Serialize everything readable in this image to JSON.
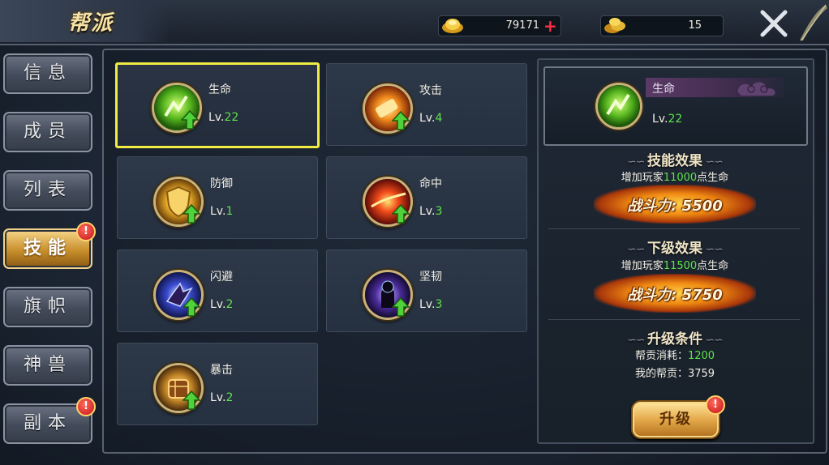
{
  "header": {
    "title": "帮派",
    "gold": "79171",
    "ingot": "15"
  },
  "tabs": [
    {
      "label": "信息",
      "active": false,
      "badge": ""
    },
    {
      "label": "成员",
      "active": false,
      "badge": ""
    },
    {
      "label": "列表",
      "active": false,
      "badge": ""
    },
    {
      "label": "技能",
      "active": true,
      "badge": "!"
    },
    {
      "label": "旗帜",
      "active": false,
      "badge": ""
    },
    {
      "label": "神兽",
      "active": false,
      "badge": ""
    },
    {
      "label": "副本",
      "active": false,
      "badge": "!"
    }
  ],
  "skills": [
    {
      "name": "生命",
      "lv_prefix": "Lv.",
      "level": "22",
      "icon": "life-icon",
      "selected": true
    },
    {
      "name": "攻击",
      "lv_prefix": "Lv.",
      "level": "4",
      "icon": "attack-icon",
      "selected": false
    },
    {
      "name": "防御",
      "lv_prefix": "Lv.",
      "level": "1",
      "icon": "defense-icon",
      "selected": false
    },
    {
      "name": "命中",
      "lv_prefix": "Lv.",
      "level": "3",
      "icon": "hit-icon",
      "selected": false
    },
    {
      "name": "闪避",
      "lv_prefix": "Lv.",
      "level": "2",
      "icon": "dodge-icon",
      "selected": false
    },
    {
      "name": "坚韧",
      "lv_prefix": "Lv.",
      "level": "3",
      "icon": "toughness-icon",
      "selected": false
    },
    {
      "name": "暴击",
      "lv_prefix": "Lv.",
      "level": "2",
      "icon": "crit-icon",
      "selected": false
    }
  ],
  "detail": {
    "name": "生命",
    "lv_prefix": "Lv.",
    "level": "22",
    "effect_title": "技能效果",
    "effect_desc_pre": "增加玩家",
    "effect_value": "11000",
    "effect_desc_post": "点生命",
    "effect_power": "战斗力: 5500",
    "next_title": "下级效果",
    "next_desc_pre": "增加玩家",
    "next_value": "11500",
    "next_desc_post": "点生命",
    "next_power": "战斗力: 5750",
    "cond_title": "升级条件",
    "cost_label": "帮贡消耗：",
    "cost_value": "1200",
    "own_label": "我的帮贡：",
    "own_value": "3759",
    "upgrade_label": "升级",
    "upgrade_badge": "!"
  },
  "colors": {
    "accent_gold": "#f1ec44",
    "level_green": "#5de34a",
    "badge_red": "#c4121a"
  }
}
